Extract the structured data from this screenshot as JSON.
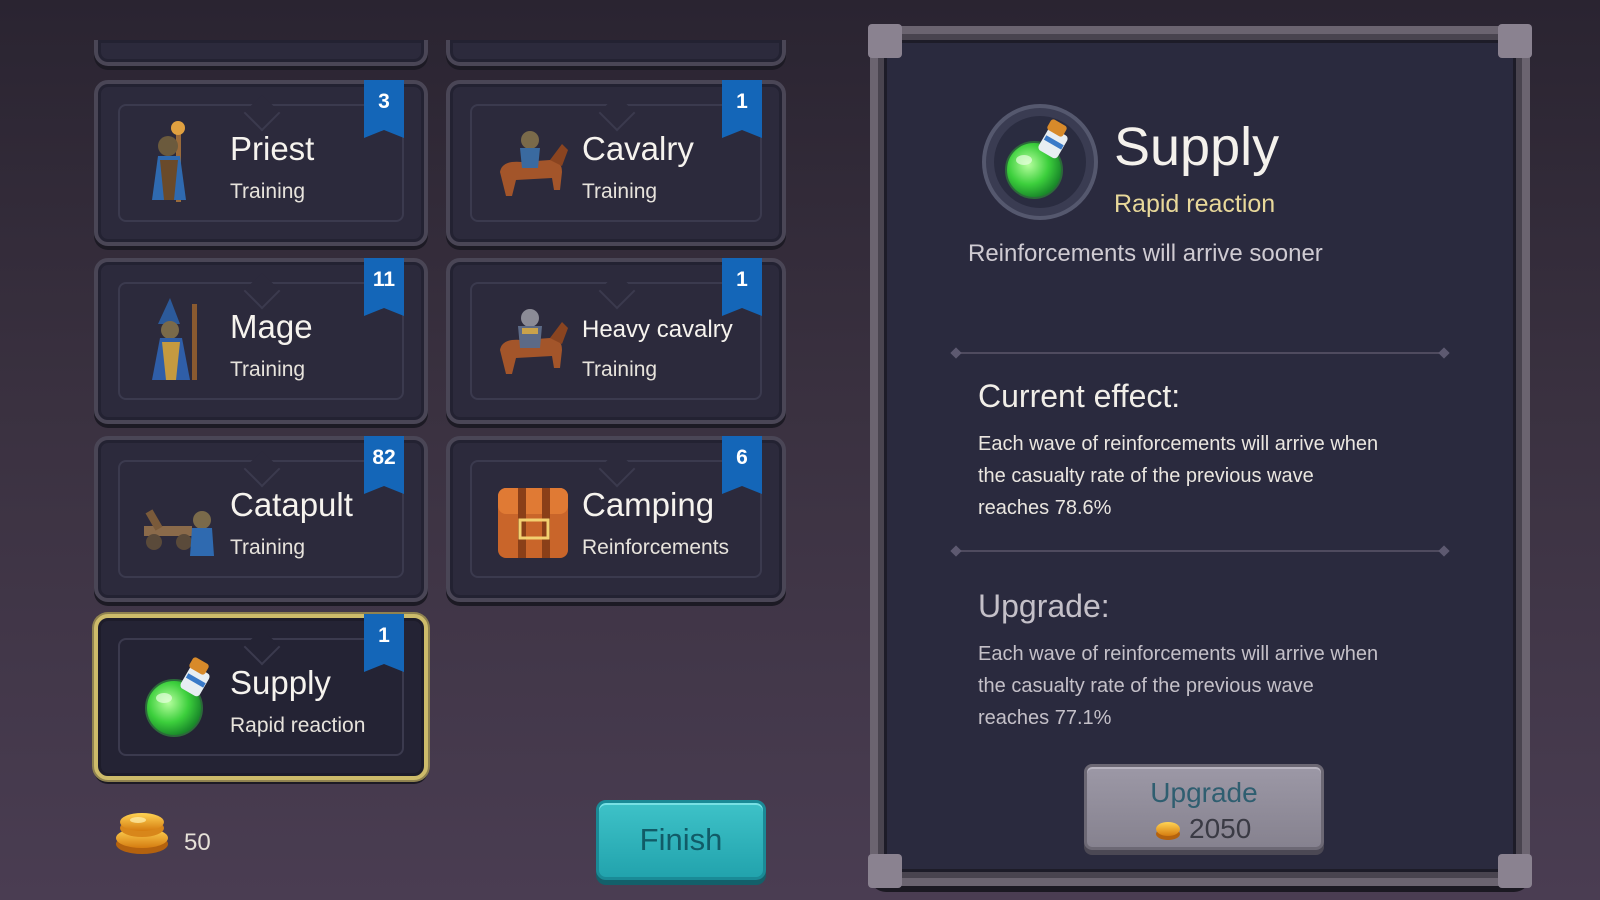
{
  "cards": [
    {
      "id": "priest",
      "name": "Priest",
      "sub": "Training",
      "badge": "3",
      "icon": "priest-icon"
    },
    {
      "id": "cavalry",
      "name": "Cavalry",
      "sub": "Training",
      "badge": "1",
      "icon": "cavalry-icon"
    },
    {
      "id": "mage",
      "name": "Mage",
      "sub": "Training",
      "badge": "11",
      "icon": "mage-icon"
    },
    {
      "id": "heavy-cavalry",
      "name": "Heavy cavalry",
      "sub": "Training",
      "badge": "1",
      "icon": "heavy-cavalry-icon"
    },
    {
      "id": "catapult",
      "name": "Catapult",
      "sub": "Training",
      "badge": "82",
      "icon": "catapult-icon"
    },
    {
      "id": "camping",
      "name": "Camping",
      "sub": "Reinforcements",
      "badge": "6",
      "icon": "backpack-icon"
    },
    {
      "id": "supply",
      "name": "Supply",
      "sub": "Rapid reaction",
      "badge": "1",
      "icon": "potion-icon",
      "selected": true
    }
  ],
  "footer": {
    "coins": "50",
    "finish_label": "Finish"
  },
  "detail": {
    "title": "Supply",
    "subtitle": "Rapid reaction",
    "description": "Reinforcements will arrive sooner",
    "current_heading": "Current effect:",
    "current_lines": [
      "Each wave of reinforcements will arrive when",
      "the casualty rate of the previous wave",
      "reaches 78.6%"
    ],
    "upgrade_heading": "Upgrade:",
    "upgrade_lines": [
      "Each wave of reinforcements will arrive when",
      "the casualty rate of the previous wave",
      "reaches 77.1%"
    ],
    "upgrade_button_label": "Upgrade",
    "upgrade_cost": "2050"
  },
  "colors": {
    "badge": "#1466b8",
    "selected_border": "#cdbb6a",
    "finish": "#2bb3bb",
    "gold": "#f2a71e"
  }
}
